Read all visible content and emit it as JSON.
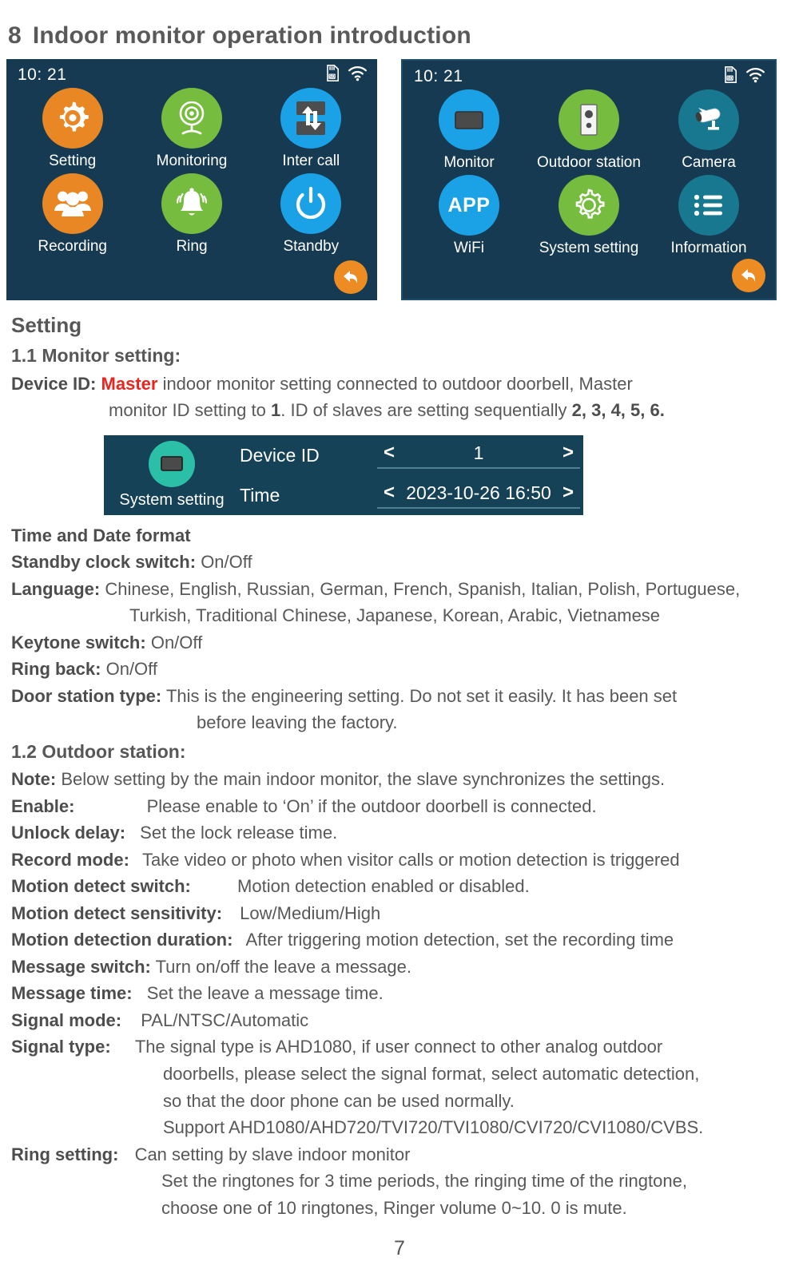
{
  "heading": {
    "number": "8",
    "text": "Indoor monitor operation introduction"
  },
  "screens": {
    "left": {
      "clock": "10: 21",
      "status_icons": [
        "sd-card-icon",
        "wifi-icon"
      ],
      "tiles": [
        {
          "label": "Setting",
          "icon": "gear-icon",
          "color": "#e98724"
        },
        {
          "label": "Monitoring",
          "icon": "webcam-icon",
          "color": "#76bc3f"
        },
        {
          "label": "Inter call",
          "icon": "inter-call-icon",
          "color": "#1ba2e6"
        },
        {
          "label": "Recording",
          "icon": "people-icon",
          "color": "#e98724"
        },
        {
          "label": "Ring",
          "icon": "bell-icon",
          "color": "#76bc3f"
        },
        {
          "label": "Standby",
          "icon": "power-icon",
          "color": "#1ba2e6"
        }
      ],
      "back_button": "return-arrow-icon"
    },
    "right": {
      "clock": "10: 21",
      "status_icons": [
        "sd-card-icon",
        "wifi-icon"
      ],
      "tiles": [
        {
          "label": "Monitor",
          "icon": "monitor-icon",
          "color": "#1ba2e6"
        },
        {
          "label": "Outdoor station",
          "icon": "door-station-icon",
          "color": "#76bc3f"
        },
        {
          "label": "Camera",
          "icon": "cctv-camera-icon",
          "color": "#17788f"
        },
        {
          "label": "WiFi",
          "icon": "app-text-icon",
          "color": "#1ba2e6",
          "text": "APP"
        },
        {
          "label": "System setting",
          "icon": "gear-outline-icon",
          "color": "#76bc3f"
        },
        {
          "label": "Information",
          "icon": "list-icon",
          "color": "#17788f"
        }
      ],
      "back_button": "return-arrow-icon"
    }
  },
  "setting_section": {
    "title": "Setting",
    "monitor_setting_title": "1.1 Monitor setting:",
    "device_id": {
      "label": "Device ID:",
      "master_word": "Master",
      "text_a": "indoor  monitor setting connected to outdoor doorbell,  Master",
      "line2_a": "monitor ID setting to ",
      "line2_id": "1",
      "line2_b": ".  ID of slaves are setting sequentially ",
      "line2_ids": "2, 3, 4, 5, 6."
    }
  },
  "setting_panel": {
    "icon_label": "System setting",
    "icon": "monitor-icon",
    "rows": [
      {
        "key": "Device ID",
        "prev": "<",
        "value": "1",
        "next": ">"
      },
      {
        "key": "Time",
        "prev": "<",
        "value": "2023-10-26 16:50",
        "next": ">"
      }
    ]
  },
  "monitor_items": {
    "time_date_format": "Time and Date format",
    "standby_clock_label": "Standby clock switch:",
    "standby_clock_value": "On/Off",
    "language_label": "Language:",
    "language_line1": "Chinese, English, Russian, German, French, Spanish, Italian, Polish, Portuguese,",
    "language_line2": "Turkish, Traditional Chinese, Japanese, Korean, Arabic, Vietnamese",
    "keytone_label": "Keytone  switch:",
    "keytone_value": "On/Off",
    "ringback_label": "Ring back:",
    "ringback_value": "On/Off",
    "doorstation_label": "Door station type:",
    "doorstation_line1": "This is the engineering setting. Do not set it easily. It has been set",
    "doorstation_line2": "before leaving the factory."
  },
  "outdoor_section": {
    "title": "1.2 Outdoor station:",
    "note_label": "Note:",
    "note_value": "Below setting by the main indoor monitor, the slave synchronizes the settings.",
    "rows": [
      {
        "label": "Enable:",
        "value": "Please enable to ‘On’ if the outdoor doorbell is connected."
      },
      {
        "label": "Unlock delay:",
        "value": "Set the lock release time."
      },
      {
        "label": "Record mode:",
        "value": "Take video or photo when visitor calls or motion detection is triggered"
      },
      {
        "label": "Motion detect switch:",
        "value": "Motion detection enabled or disabled."
      },
      {
        "label": "Motion detect sensitivity:",
        "value": "Low/Medium/High"
      },
      {
        "label": "Motion detection duration:",
        "value": "After triggering motion detection, set the recording time"
      },
      {
        "label": "Message switch:",
        "value": "Turn on/off the leave a message."
      },
      {
        "label": "Message time:",
        "value": "Set the leave a message time."
      },
      {
        "label": "Signal mode:",
        "value": "PAL/NTSC/Automatic"
      }
    ],
    "signal_type": {
      "label": "Signal type:",
      "line1": "The signal type is AHD1080, if user connect to other analog outdoor",
      "line2": "doorbells, please select the signal format, select automatic detection,",
      "line3": "so that the door phone can be used normally.",
      "line4": "Support AHD1080/AHD720/TVI720/TVI1080/CVI720/CVI1080/CVBS."
    },
    "ring_setting": {
      "label": "Ring setting:",
      "line1": "Can setting by slave indoor monitor",
      "line2": "Set the ringtones for 3 time periods, the ringing time of the ringtone,",
      "line3": "choose one of 10 ringtones, Ringer volume 0~10. 0 is mute."
    }
  },
  "page_number": "7"
}
